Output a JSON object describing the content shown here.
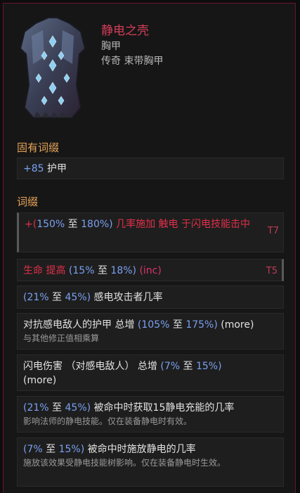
{
  "item": {
    "name": "静电之壳",
    "type": "胸甲",
    "rarity": "传奇 束带胸甲"
  },
  "sections": {
    "implicit_title": "固有词缀",
    "affix_title": "词缀"
  },
  "implicit": {
    "value": "+85",
    "label": " 护甲"
  },
  "affixes": [
    {
      "prefix": "+(",
      "min": "150%",
      "to": " 至 ",
      "max": "180%",
      "close": ") ",
      "text": "几率施加 触电 于闪电技能击中",
      "tier": "T7"
    },
    {
      "lead": "生命 提高 ",
      "open": "(",
      "min": "15%",
      "to": " 至 ",
      "max": "18%",
      "close": ") ",
      "tag": "(inc)",
      "tier": "T5"
    },
    {
      "open": "(",
      "min": "21%",
      "to": " 至 ",
      "max": "45%",
      "close": ") ",
      "text": "感电攻击者几率"
    },
    {
      "lead": "对抗感电敌人的护甲 总增 ",
      "open": "(",
      "min": "105%",
      "to": " 至 ",
      "max": "175%",
      "close": ") ",
      "tag": "(more)",
      "sub": "与其他修正值相乘算"
    },
    {
      "lead": "闪电伤害 （对感电敌人） 总增 ",
      "open": "(",
      "min": "7%",
      "to": " 至 ",
      "max": "15%",
      "close": ")",
      "tag": "(more)"
    },
    {
      "open": "(",
      "min": "21%",
      "to": " 至 ",
      "max": "45%",
      "close": ") ",
      "text": "被命中时获取15静电充能的几率",
      "sub": "影响法师的静电技能。仅在装备静电时有效。"
    },
    {
      "open": "(",
      "min": "7%",
      "to": " 至 ",
      "max": "15%",
      "close": ") ",
      "text": "被命中时施放静电的几率",
      "sub": "施放该效果受静电技能树影响。仅在装备静电时生效。"
    }
  ],
  "colors": {
    "name": "#d43e5a",
    "section": "#e9a45a",
    "value": "#7aa0f0",
    "highlight": "#e0304a",
    "frame": "#6a1330"
  },
  "icons": {
    "item_art": "chest-armor-icon"
  }
}
